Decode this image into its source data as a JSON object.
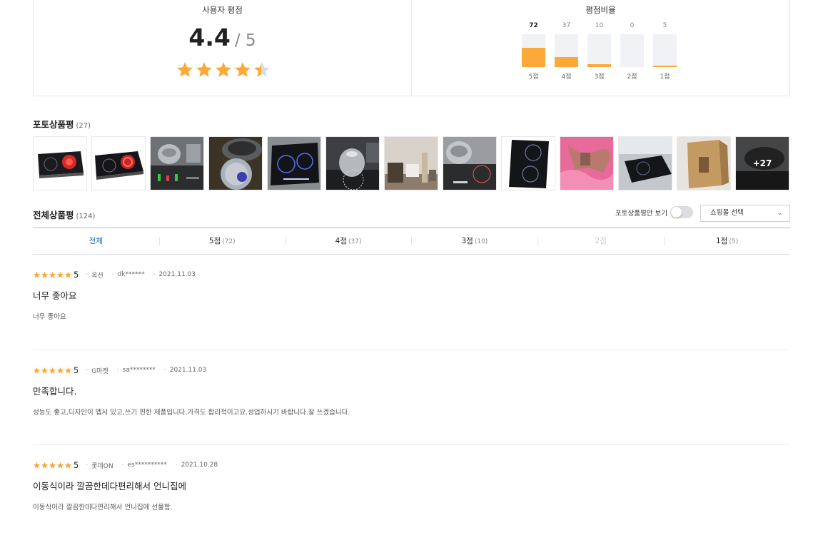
{
  "summary": {
    "user_rating_title": "사용자 평점",
    "score": "4.4",
    "score_max": "/ 5",
    "rating_value": 4.4,
    "distribution_title": "평점비율",
    "distribution": [
      {
        "label": "5점",
        "count": "72",
        "value": 72
      },
      {
        "label": "4점",
        "count": "37",
        "value": 37
      },
      {
        "label": "3점",
        "count": "10",
        "value": 10
      },
      {
        "label": "2점",
        "count": "0",
        "value": 0
      },
      {
        "label": "1점",
        "count": "5",
        "value": 5
      }
    ]
  },
  "photo_reviews": {
    "title": "포토상품평",
    "count": "(27)",
    "more_label": "+27"
  },
  "all_reviews": {
    "title": "전체상품평",
    "count": "(124)",
    "photo_only_label": "포토상품평만 보기",
    "mall_select_label": "쇼핑몰 선택",
    "tabs": [
      {
        "label": "전체",
        "count": ""
      },
      {
        "label": "5점",
        "count": "(72)"
      },
      {
        "label": "4점",
        "count": "(37)"
      },
      {
        "label": "3점",
        "count": "(10)"
      },
      {
        "label": "2점",
        "count": ""
      },
      {
        "label": "1점",
        "count": "(5)"
      }
    ]
  },
  "reviews": [
    {
      "score": "5",
      "mall": "옥션",
      "user": "dk******",
      "date": "2021.11.03",
      "title": "너무 좋아요",
      "body": "너무 좋아요"
    },
    {
      "score": "5",
      "mall": "G마켓",
      "user": "sa********",
      "date": "2021.11.03",
      "title": "만족합니다.",
      "body": "성능도 좋고,디자인이 멥시 있고,쓰기 편한 제품입니다.가격도 합리적이고요.성업하시기 바랍니다.잘 쓰겠습니다."
    },
    {
      "score": "5",
      "mall": "롯데ON",
      "user": "es**********",
      "date": "2021.10.28",
      "title": "이동식이라 깔끔한데다편리해서 언니집에",
      "body": "이동식이라 깔끔한데다편리해서 언니집에 선물함."
    }
  ],
  "colors": {
    "star": "#fca93a",
    "star_empty": "#d9dbe0",
    "accent": "#1565c0"
  }
}
